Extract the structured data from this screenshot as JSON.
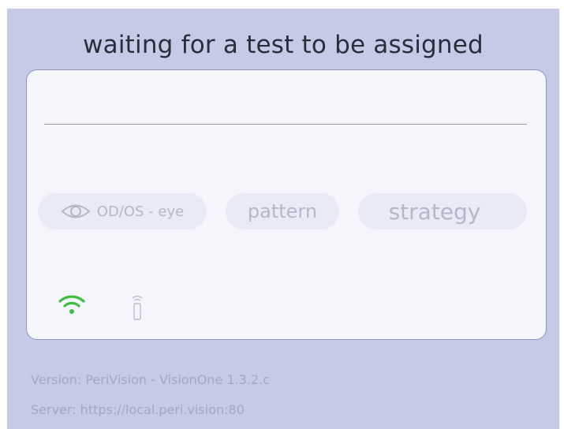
{
  "header": {
    "status_text": "waiting for a test to be assigned"
  },
  "test_card": {
    "eye_chip": {
      "label": "OD/OS - eye",
      "icon": "eye-icon"
    },
    "pattern_chip": {
      "label": "pattern"
    },
    "strategy_chip": {
      "label": "strategy"
    },
    "status_icons": {
      "wifi": {
        "icon": "wifi-icon",
        "color": "#3fbf3f",
        "state": "connected"
      },
      "remote": {
        "icon": "remote-control-icon",
        "color": "#b8bcc9",
        "state": "disconnected"
      }
    }
  },
  "footer": {
    "version": "Version: PeriVision - VisionOne 1.3.2.c",
    "server": "Server: https://local.peri.vision:80"
  },
  "colors": {
    "background": "#c5cbe6",
    "card_background": "#f4f6fc",
    "card_border": "#8d95c2",
    "chip_background": "#e8ebf6",
    "chip_text": "#b3b8c8",
    "footer_text": "#a3a8bf"
  }
}
